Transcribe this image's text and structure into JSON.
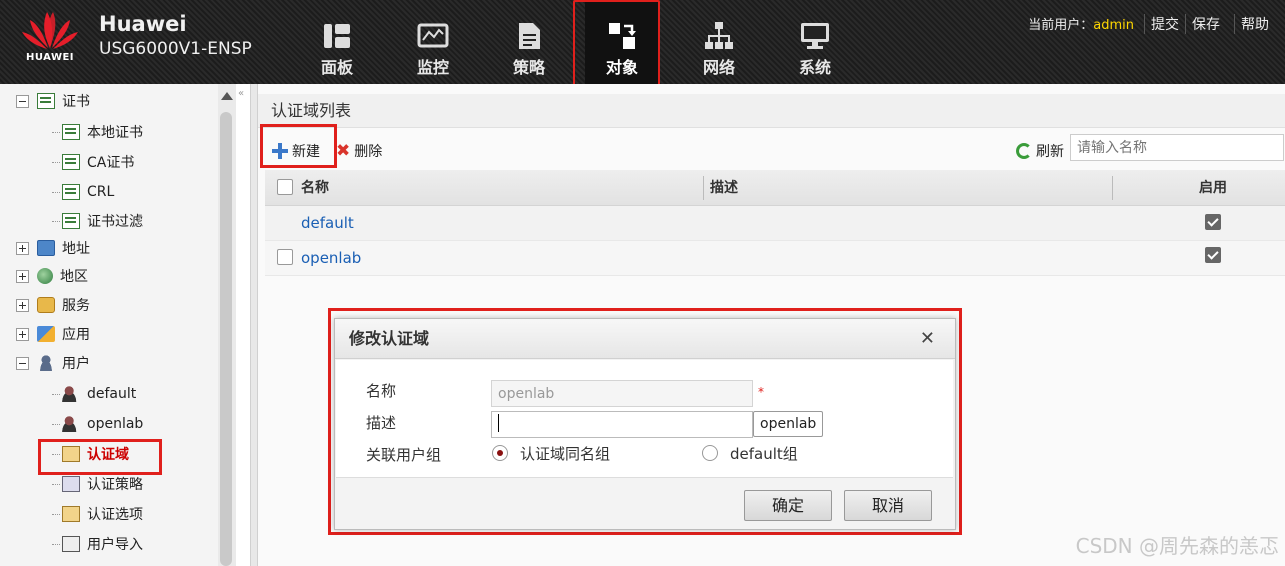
{
  "header": {
    "logo_text": "HUAWEI",
    "brand_name": "Huawei",
    "brand_model": "USG6000V1-ENSP",
    "nav": [
      {
        "label": "面板",
        "icon": "dashboard-icon"
      },
      {
        "label": "监控",
        "icon": "monitor-icon"
      },
      {
        "label": "策略",
        "icon": "policy-icon"
      },
      {
        "label": "对象",
        "icon": "object-icon"
      },
      {
        "label": "网络",
        "icon": "network-icon"
      },
      {
        "label": "系统",
        "icon": "system-icon"
      }
    ],
    "active_nav": "对象",
    "current_user_label": "当前用户：",
    "current_user": "admin",
    "actions": [
      "提交",
      "保存",
      "帮助"
    ]
  },
  "sidebar": {
    "items": [
      {
        "label": "证书",
        "icon": "certificate-icon",
        "level": 0,
        "expanded": true
      },
      {
        "label": "本地证书",
        "icon": "local-cert-icon",
        "level": 1
      },
      {
        "label": "CA证书",
        "icon": "ca-cert-icon",
        "level": 1
      },
      {
        "label": "CRL",
        "icon": "crl-icon",
        "level": 1
      },
      {
        "label": "证书过滤",
        "icon": "cert-filter-icon",
        "level": 1
      },
      {
        "label": "地址",
        "icon": "address-icon",
        "level": 0,
        "expanded": false
      },
      {
        "label": "地区",
        "icon": "region-icon",
        "level": 0,
        "expanded": false
      },
      {
        "label": "服务",
        "icon": "service-icon",
        "level": 0,
        "expanded": false
      },
      {
        "label": "应用",
        "icon": "application-icon",
        "level": 0,
        "expanded": false
      },
      {
        "label": "用户",
        "icon": "user-icon",
        "level": 0,
        "expanded": true
      },
      {
        "label": "default",
        "icon": "user-group-icon",
        "level": 1
      },
      {
        "label": "openlab",
        "icon": "user-group-icon",
        "level": 1
      },
      {
        "label": "认证域",
        "icon": "auth-domain-icon",
        "level": 1,
        "selected": true
      },
      {
        "label": "认证策略",
        "icon": "auth-policy-icon",
        "level": 1
      },
      {
        "label": "认证选项",
        "icon": "auth-options-icon",
        "level": 1
      },
      {
        "label": "用户导入",
        "icon": "user-import-icon",
        "level": 1
      }
    ]
  },
  "main": {
    "title": "认证域列表",
    "toolbar": {
      "new_label": "新建",
      "delete_label": "删除",
      "refresh_label": "刷新",
      "search_placeholder": "请输入名称"
    },
    "table": {
      "columns": [
        "名称",
        "描述",
        "启用"
      ],
      "rows": [
        {
          "name": "default",
          "desc": "",
          "enabled": true
        },
        {
          "name": "openlab",
          "desc": "",
          "enabled": true
        }
      ]
    }
  },
  "modal": {
    "title": "修改认证域",
    "fields": {
      "name_label": "名称",
      "name_value": "openlab",
      "required_mark": "*",
      "desc_label": "描述",
      "desc_value": "",
      "desc_tooltip": "openlab",
      "group_label": "关联用户组",
      "group_options": [
        "认证域同名组",
        "default组"
      ],
      "group_selected": "认证域同名组"
    },
    "ok_label": "确定",
    "cancel_label": "取消"
  },
  "watermark": "CSDN @周先森的恙忑",
  "colors": {
    "highlight": "#e0201c",
    "link": "#1a5fb4",
    "user": "#ffd700"
  }
}
